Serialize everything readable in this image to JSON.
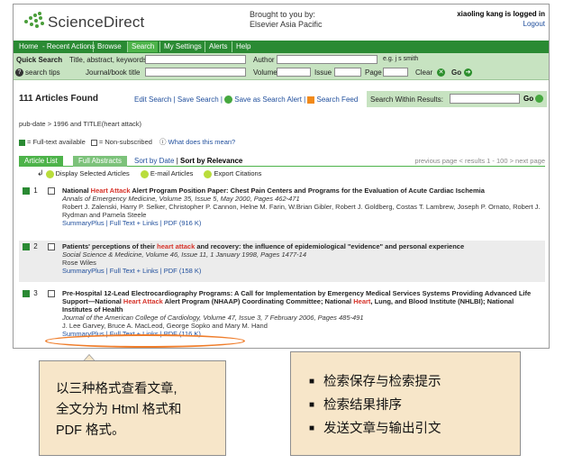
{
  "header": {
    "logo_text": "ScienceDirect",
    "brought_line1": "Brought to you by:",
    "brought_line2": "Elsevier Asia Pacific",
    "user_text": "xiaoling kang is logged in",
    "logout": "Logout"
  },
  "nav": {
    "items": [
      "Home",
      "Recent Actions",
      "Browse",
      "Search",
      "My Settings",
      "Alerts",
      "Help"
    ],
    "active": "Search"
  },
  "quick_search": {
    "label": "Quick Search",
    "title_label": "Title, abstract, keywords",
    "author_label": "Author",
    "author_hint": "e.g. j s smith",
    "tips": "search tips",
    "journal_label": "Journal/book title",
    "volume_label": "Volume",
    "issue_label": "Issue",
    "page_label": "Page",
    "clear": "Clear",
    "go": "Go"
  },
  "results_bar": {
    "count": "111 Articles Found",
    "edit_search": "Edit Search",
    "save_search": "Save Search",
    "save_alert": "Save as Search Alert",
    "search_feed": "Search Feed",
    "within_label": "Search Within Results:",
    "go": "Go"
  },
  "query": "pub-date > 1996 and TITLE(heart attack)",
  "legend": {
    "full_text": "= Full-text available",
    "non_sub": "= Non-subscribed",
    "what": "What does this mean?"
  },
  "tabs": {
    "article_list": "Article List",
    "full_abstracts": "Full Abstracts",
    "sort_by_date": "Sort by Date",
    "sort_by_relevance": "Sort by Relevance",
    "pager": "previous page < results 1 - 100 > next page"
  },
  "toolbar": {
    "display": "Display Selected Articles",
    "email": "E-mail Articles",
    "export": "Export Citations"
  },
  "results": [
    {
      "num": "1",
      "title_pre": "National ",
      "title_hl": "Heart Attack",
      "title_post": " Alert Program Position Paper: Chest Pain Centers and Programs for the Evaluation of Acute Cardiac Ischemia",
      "source": "Annals of Emergency Medicine, Volume 35, Issue 5, May 2000, Pages 462-471",
      "authors": "Robert J. Zalenski, Harry P. Selker, Christopher P. Cannon, Helne M. Farin, W.Brian Gibler, Robert J. Goldberg, Costas T. Lambrew, Joseph P. Ornato, Robert J. Rydman and Pamela Steele",
      "links": "SummaryPlus | Full Text + Links | PDF (916 K)"
    },
    {
      "num": "2",
      "title_pre": "Patients' perceptions of their ",
      "title_hl": "heart attack",
      "title_post": " and recovery: the influence of epidemiological \"evidence\" and personal experience",
      "source": "Social Science & Medicine, Volume 46, Issue 11, 1 January 1998, Pages 1477-14",
      "authors": "Rose Wiles",
      "links": "SummaryPlus | Full Text + Links | PDF (158 K)"
    },
    {
      "num": "3",
      "title_pre": "Pre-Hospital 12-Lead Electrocardiography Programs: A Call for Implementation by Emergency Medical Services Systems Providing Advanced Life Support—National ",
      "title_hl": "Heart Attack",
      "title_mid": " Alert Program (NHAAP) Coordinating Committee; National ",
      "title_hl2": "Heart",
      "title_post": ", Lung, and Blood Institute (NHLBI); National Institutes of Health",
      "source": "Journal of the American College of Cardiology, Volume 47, Issue 3, 7 February 2006, Pages 485-491",
      "authors": "J. Lee Garvey, Bruce A. MacLeod, George Sopko and Mary M. Hand",
      "links": "SummaryPlus | Full Text + Links | PDF (116 K)"
    }
  ],
  "callouts": {
    "left_line1": "以三种格式查看文章,",
    "left_line2": "全文分为 Html 格式和",
    "left_line3": "PDF 格式。",
    "right_items": [
      "检索保存与检索提示",
      "检索结果排序",
      "发送文章与输出引文"
    ]
  },
  "colors": {
    "nav_green": "#2a8a33",
    "search_bg": "#c7e3c1",
    "highlight_red": "#d6332a",
    "link_blue": "#1f4e9c",
    "callout_bg": "#f7e6c9",
    "ellipse_orange": "#ef7d2b"
  }
}
